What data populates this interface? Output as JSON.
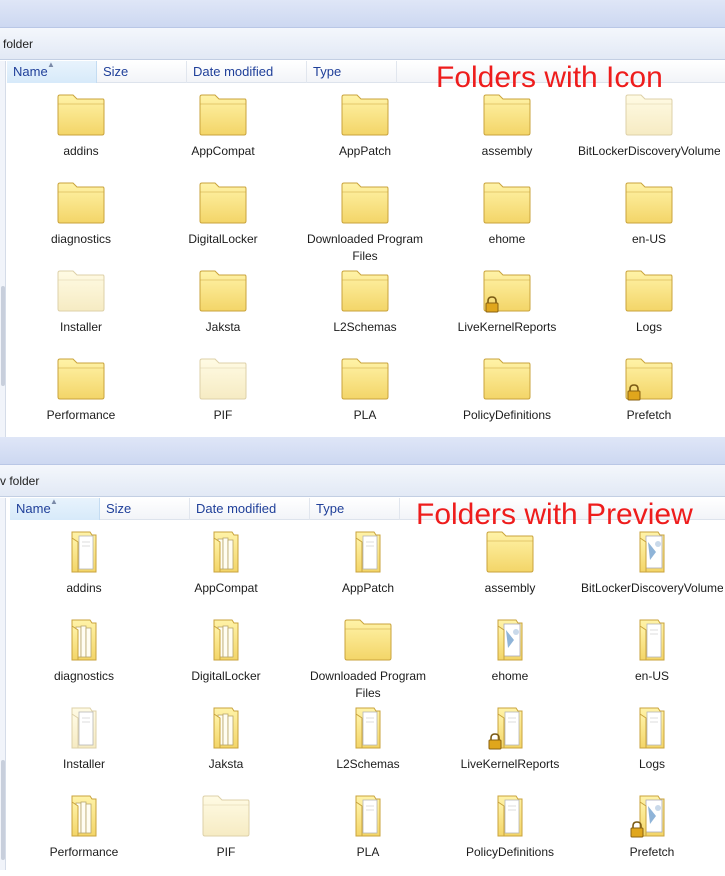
{
  "panels": [
    {
      "breadcrumb": "folder",
      "columns": [
        "Name",
        "Size",
        "Date modified",
        "Type"
      ],
      "annotation": "Folders with Icon",
      "items": [
        {
          "name": "addins",
          "style": "folder"
        },
        {
          "name": "AppCompat",
          "style": "folder"
        },
        {
          "name": "AppPatch",
          "style": "folder"
        },
        {
          "name": "assembly",
          "style": "folder"
        },
        {
          "name": "BitLockerDiscoveryVolumeContents",
          "style": "folder-faded"
        },
        {
          "name": "diagnostics",
          "style": "folder"
        },
        {
          "name": "DigitalLocker",
          "style": "folder"
        },
        {
          "name": "Downloaded Program Files",
          "style": "folder"
        },
        {
          "name": "ehome",
          "style": "folder"
        },
        {
          "name": "en-US",
          "style": "folder"
        },
        {
          "name": "Installer",
          "style": "folder-faded"
        },
        {
          "name": "Jaksta",
          "style": "folder"
        },
        {
          "name": "L2Schemas",
          "style": "folder"
        },
        {
          "name": "LiveKernelReports",
          "style": "folder-locked"
        },
        {
          "name": "Logs",
          "style": "folder"
        },
        {
          "name": "Performance",
          "style": "folder"
        },
        {
          "name": "PIF",
          "style": "folder-faded"
        },
        {
          "name": "PLA",
          "style": "folder"
        },
        {
          "name": "PolicyDefinitions",
          "style": "folder"
        },
        {
          "name": "Prefetch",
          "style": "folder-locked"
        }
      ]
    },
    {
      "breadcrumb": "v folder",
      "columns": [
        "Name",
        "Size",
        "Date modified",
        "Type"
      ],
      "annotation": "Folders with Preview",
      "items": [
        {
          "name": "addins",
          "style": "preview-doc"
        },
        {
          "name": "AppCompat",
          "style": "preview-files"
        },
        {
          "name": "AppPatch",
          "style": "preview-doc"
        },
        {
          "name": "assembly",
          "style": "folder"
        },
        {
          "name": "BitLockerDiscoveryVolumeContents",
          "style": "preview-image"
        },
        {
          "name": "diagnostics",
          "style": "preview-files"
        },
        {
          "name": "DigitalLocker",
          "style": "preview-files"
        },
        {
          "name": "Downloaded Program Files",
          "style": "folder"
        },
        {
          "name": "ehome",
          "style": "preview-image"
        },
        {
          "name": "en-US",
          "style": "preview-doc"
        },
        {
          "name": "Installer",
          "style": "preview-faded"
        },
        {
          "name": "Jaksta",
          "style": "preview-files"
        },
        {
          "name": "L2Schemas",
          "style": "preview-doc"
        },
        {
          "name": "LiveKernelReports",
          "style": "preview-locked"
        },
        {
          "name": "Logs",
          "style": "preview-doc"
        },
        {
          "name": "Performance",
          "style": "preview-files"
        },
        {
          "name": "PIF",
          "style": "folder-faded"
        },
        {
          "name": "PLA",
          "style": "preview-doc"
        },
        {
          "name": "PolicyDefinitions",
          "style": "preview-doc"
        },
        {
          "name": "Prefetch",
          "style": "preview-locked-image"
        }
      ]
    }
  ],
  "colors": {
    "folder_top": "#fff3a8",
    "folder_bottom": "#f3d568",
    "folder_edge": "#c9a33c",
    "annotation": "#ee1c1c",
    "column_header_text": "#1f3f99"
  }
}
